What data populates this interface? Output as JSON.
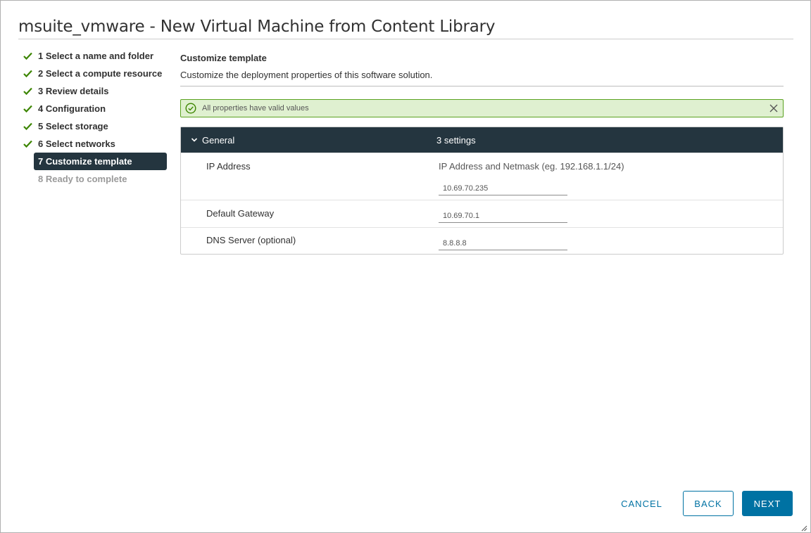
{
  "dialog": {
    "title": "msuite_vmware - New Virtual Machine from Content Library"
  },
  "steps": [
    {
      "label": "1 Select a name and folder",
      "state": "done"
    },
    {
      "label": "2 Select a compute resource",
      "state": "done"
    },
    {
      "label": "3 Review details",
      "state": "done"
    },
    {
      "label": "4 Configuration",
      "state": "done"
    },
    {
      "label": "5 Select storage",
      "state": "done"
    },
    {
      "label": "6 Select networks",
      "state": "done"
    },
    {
      "label": "7 Customize template",
      "state": "active"
    },
    {
      "label": "8 Ready to complete",
      "state": "future"
    }
  ],
  "section": {
    "title": "Customize template",
    "description": "Customize the deployment properties of this software solution."
  },
  "alert": {
    "message": "All properties have valid values",
    "icon": "check-circle-icon",
    "close_icon": "close-icon"
  },
  "group": {
    "name": "General",
    "count": "3 settings"
  },
  "properties": {
    "ip_address": {
      "label": "IP Address",
      "hint": "IP Address and Netmask (eg. 192.168.1.1/24)",
      "value": "10.69.70.235"
    },
    "gateway": {
      "label": "Default Gateway",
      "value": "10.69.70.1"
    },
    "dns": {
      "label": "DNS Server (optional)",
      "value": "8.8.8.8"
    }
  },
  "buttons": {
    "cancel": "CANCEL",
    "back": "BACK",
    "next": "NEXT"
  },
  "colors": {
    "accent": "#0072a3",
    "header_dark": "#24353f",
    "success": "#5aa220",
    "success_bg": "#dff0d0",
    "check": "#3c8500"
  }
}
